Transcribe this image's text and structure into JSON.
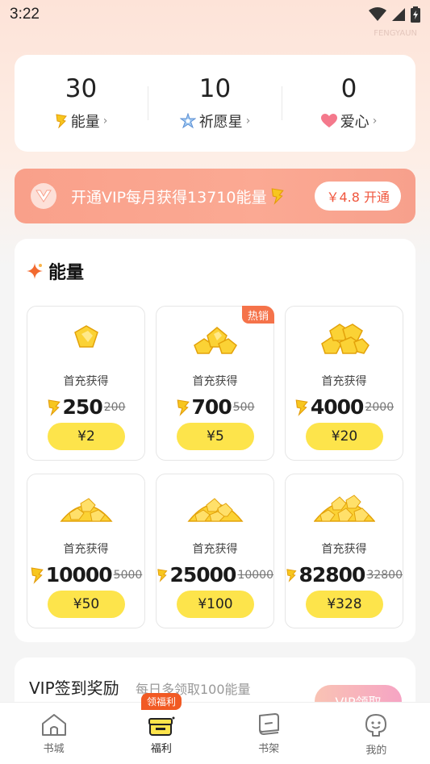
{
  "status_bar": {
    "time": "3:22",
    "watermark": "FENGYAUN"
  },
  "stats": [
    {
      "value": "30",
      "label": "能量",
      "icon": "energy-icon"
    },
    {
      "value": "10",
      "label": "祈愿星",
      "icon": "wish-star-icon"
    },
    {
      "value": "0",
      "label": "爱心",
      "icon": "heart-icon"
    }
  ],
  "vip_banner": {
    "text": "开通VIP每月获得13710能量",
    "button": "￥4.8 开通",
    "colors": {
      "banner": "#f9a08a",
      "button_text": "#f0563e"
    }
  },
  "energy_section": {
    "title": "能量",
    "packs": [
      {
        "note": "首充获得",
        "amount": "250",
        "original": "200",
        "price": "¥2",
        "badge": ""
      },
      {
        "note": "首充获得",
        "amount": "700",
        "original": "500",
        "price": "¥5",
        "badge": "热销"
      },
      {
        "note": "首充获得",
        "amount": "4000",
        "original": "2000",
        "price": "¥20",
        "badge": ""
      },
      {
        "note": "首充获得",
        "amount": "10000",
        "original": "5000",
        "price": "¥50",
        "badge": ""
      },
      {
        "note": "首充获得",
        "amount": "25000",
        "original": "10000",
        "price": "¥100",
        "badge": ""
      },
      {
        "note": "首充获得",
        "amount": "82800",
        "original": "32800",
        "price": "¥328",
        "badge": ""
      }
    ]
  },
  "checkin": {
    "title": "VIP签到奖励",
    "subtitle": "每日多领取100能量",
    "button": "VIP领取"
  },
  "tab_bar": {
    "tabs": [
      {
        "label": "书城",
        "icon": "bookstore-icon"
      },
      {
        "label": "福利",
        "icon": "gift-box-icon",
        "badge": "领福利"
      },
      {
        "label": "书架",
        "icon": "bookshelf-icon"
      },
      {
        "label": "我的",
        "icon": "profile-icon"
      }
    ],
    "active": "福利"
  },
  "colors": {
    "accent_yellow": "#fde44b",
    "hot_badge": "#f5734a",
    "tab_badge": "#f15a24"
  }
}
